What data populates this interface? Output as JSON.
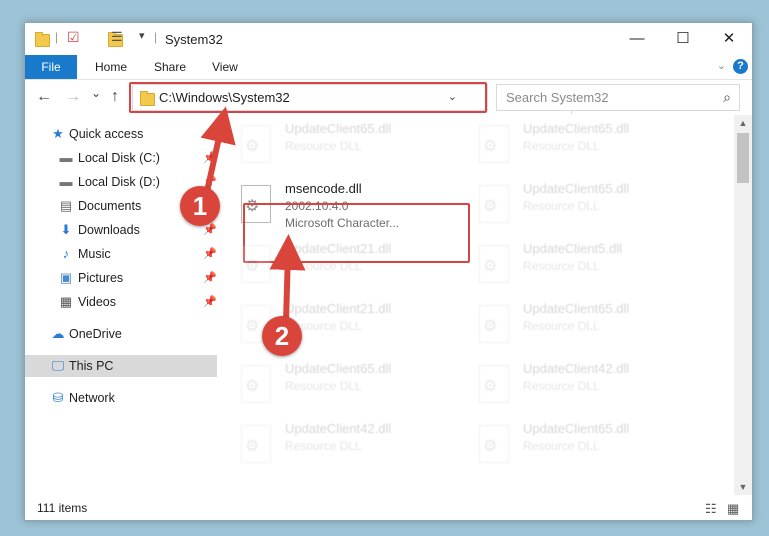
{
  "window": {
    "title": "System32",
    "controls": {
      "minimize": "—",
      "maximize": "☐",
      "close": "✕"
    }
  },
  "ribbon": {
    "tabs": [
      "File",
      "Home",
      "Share",
      "View"
    ],
    "help": "?"
  },
  "nav": {
    "back": "←",
    "forward": "→",
    "recent": "⌄",
    "up": "↑",
    "address": "C:\\Windows\\System32",
    "address_dropdown": "⌄",
    "refresh": "↻",
    "search_placeholder": "Search System32",
    "search_icon": "⌕"
  },
  "sidebar": {
    "items": [
      {
        "label": "Quick access",
        "icon": "star-icon",
        "glyph": "★",
        "pinned": false
      },
      {
        "label": "Local Disk (C:)",
        "icon": "drive-icon",
        "glyph": "▬",
        "pinned": true
      },
      {
        "label": "Local Disk (D:)",
        "icon": "drive-icon",
        "glyph": "▬",
        "pinned": true
      },
      {
        "label": "Documents",
        "icon": "documents-icon",
        "glyph": "▤",
        "pinned": true
      },
      {
        "label": "Downloads",
        "icon": "download-icon",
        "glyph": "⬇",
        "pinned": true
      },
      {
        "label": "Music",
        "icon": "music-icon",
        "glyph": "♪",
        "pinned": true
      },
      {
        "label": "Pictures",
        "icon": "pictures-icon",
        "glyph": "▣",
        "pinned": true
      },
      {
        "label": "Videos",
        "icon": "videos-icon",
        "glyph": "▦",
        "pinned": true
      },
      {
        "label": "OneDrive",
        "icon": "cloud-icon",
        "glyph": "☁",
        "pinned": false
      },
      {
        "label": "This PC",
        "icon": "computer-icon",
        "glyph": "🖵",
        "pinned": false,
        "selected": true
      },
      {
        "label": "Network",
        "icon": "network-icon",
        "glyph": "⛁",
        "pinned": false
      }
    ],
    "pin_glyph": "📌"
  },
  "files": {
    "highlighted": {
      "name": "msencode.dll",
      "version": "2002.10.4.0",
      "description": "Microsoft Character..."
    },
    "dimmed": [
      {
        "name": "UpdateClient65.dll",
        "type": "Resource DLL"
      },
      {
        "name": "UpdateClient65.dll",
        "type": "Resource DLL"
      },
      {
        "name": "UpdateClient65.dll",
        "type": "Resource DLL"
      },
      {
        "name": "UpdateClient21.dll",
        "type": "Resource DLL"
      },
      {
        "name": "UpdateClient5.dll",
        "type": "Resource DLL"
      },
      {
        "name": "UpdateClient21.dll",
        "type": "Resource DLL"
      },
      {
        "name": "UpdateClient65.dll",
        "type": "Resource DLL"
      },
      {
        "name": "UpdateClient65.dll",
        "type": "Resource DLL"
      },
      {
        "name": "UpdateClient42.dll",
        "type": "Resource DLL"
      },
      {
        "name": "UpdateClient42.dll",
        "type": "Resource DLL"
      },
      {
        "name": "UpdateClient65.dll",
        "type": "Resource DLL"
      }
    ]
  },
  "status": {
    "item_count": "111 items"
  },
  "callouts": [
    "1",
    "2"
  ],
  "colors": {
    "accent": "#1979ca",
    "highlight": "#d64545",
    "callout": "#d9453b"
  }
}
